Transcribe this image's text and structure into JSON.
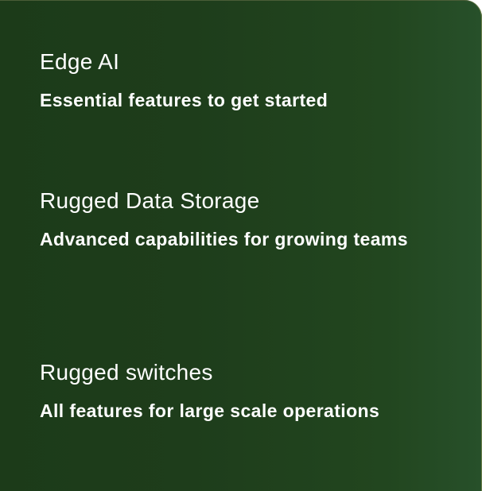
{
  "menu": {
    "items": [
      {
        "title": "Edge AI",
        "description": "Essential features to get started"
      },
      {
        "title": "Rugged Data Storage",
        "description": "Advanced capabilities for growing teams"
      },
      {
        "title": "Rugged switches",
        "description": "All features for large scale operations"
      }
    ]
  },
  "colors": {
    "background": "#1e3d1b",
    "text": "#ffffff",
    "border": "#6b7f4a"
  }
}
